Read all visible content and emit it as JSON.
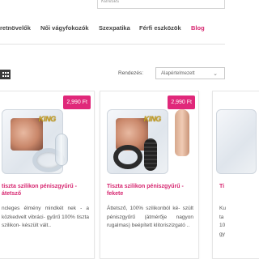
{
  "search": {
    "placeholder": "Keresés"
  },
  "nav": {
    "items": [
      {
        "label": "retnövelők"
      },
      {
        "label": "Női vágyfokozók"
      },
      {
        "label": "Szexpatika"
      },
      {
        "label": "Férfi eszközök"
      },
      {
        "label": "Blog"
      }
    ],
    "active_index": 4
  },
  "toolbar": {
    "sort_label": "Rendezés:",
    "sort_value": "Alapértelmezett",
    "view_icon": "grid-icon"
  },
  "products": [
    {
      "price": "2,990 Ft",
      "title": "tiszta szilikon péniszgyűrű - átetsző",
      "description": "ncleges élmény mindkét nek - a közkedvelt vibráci- gyűrű 100% tiszta szilikon- készült vált..",
      "image": "clear-ring-package"
    },
    {
      "price": "2,990 Ft",
      "title": "Tiszta szilikon péniszgyűrű - fekete",
      "description": "Áttetsző, 100% szilikonból ké- szült péniszgyűrű (átmérője nagyon rugalmas) beépített klitoriszizgató ..",
      "image": "black-ring-package"
    },
    {
      "price": "",
      "title": "Ti",
      "description": "Ku ta 10 gy",
      "image": "package-partial"
    }
  ],
  "colors": {
    "accent": "#d6256f",
    "price_badge": "#e0287a",
    "text": "#555555"
  }
}
